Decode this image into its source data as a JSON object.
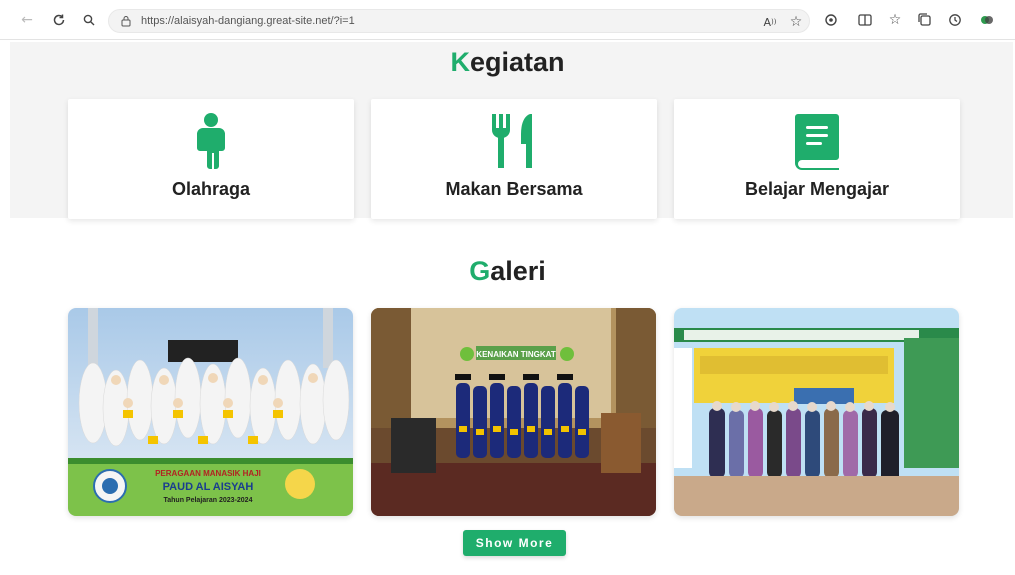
{
  "browser": {
    "url": "https://alaisyah-dangiang.great-site.net/?i=1"
  },
  "kegiatan": {
    "title_first": "K",
    "title_rest": "egiatan",
    "cards": [
      {
        "label": "Olahraga",
        "icon": "person-icon"
      },
      {
        "label": "Makan Bersama",
        "icon": "fork-knife-icon"
      },
      {
        "label": "Belajar Mengajar",
        "icon": "book-icon"
      }
    ]
  },
  "galeri": {
    "title_first": "G",
    "title_rest": "aleri",
    "images": [
      {
        "name": "manasik-haji-photo",
        "banner_lines": [
          "PERAGAAN MANASIK HAJI",
          "PAUD AL AISYAH",
          "Tahun Pelajaran 2023-2024"
        ]
      },
      {
        "name": "graduation-stage-photo",
        "banner_lines": [
          "KENAIKAN TINGKAT"
        ]
      },
      {
        "name": "school-building-group-photo",
        "banner_lines": []
      }
    ],
    "show_more_label": "Show More"
  },
  "colors": {
    "accent": "#1fad6c",
    "text": "#222222",
    "band": "#f4f4f4"
  }
}
